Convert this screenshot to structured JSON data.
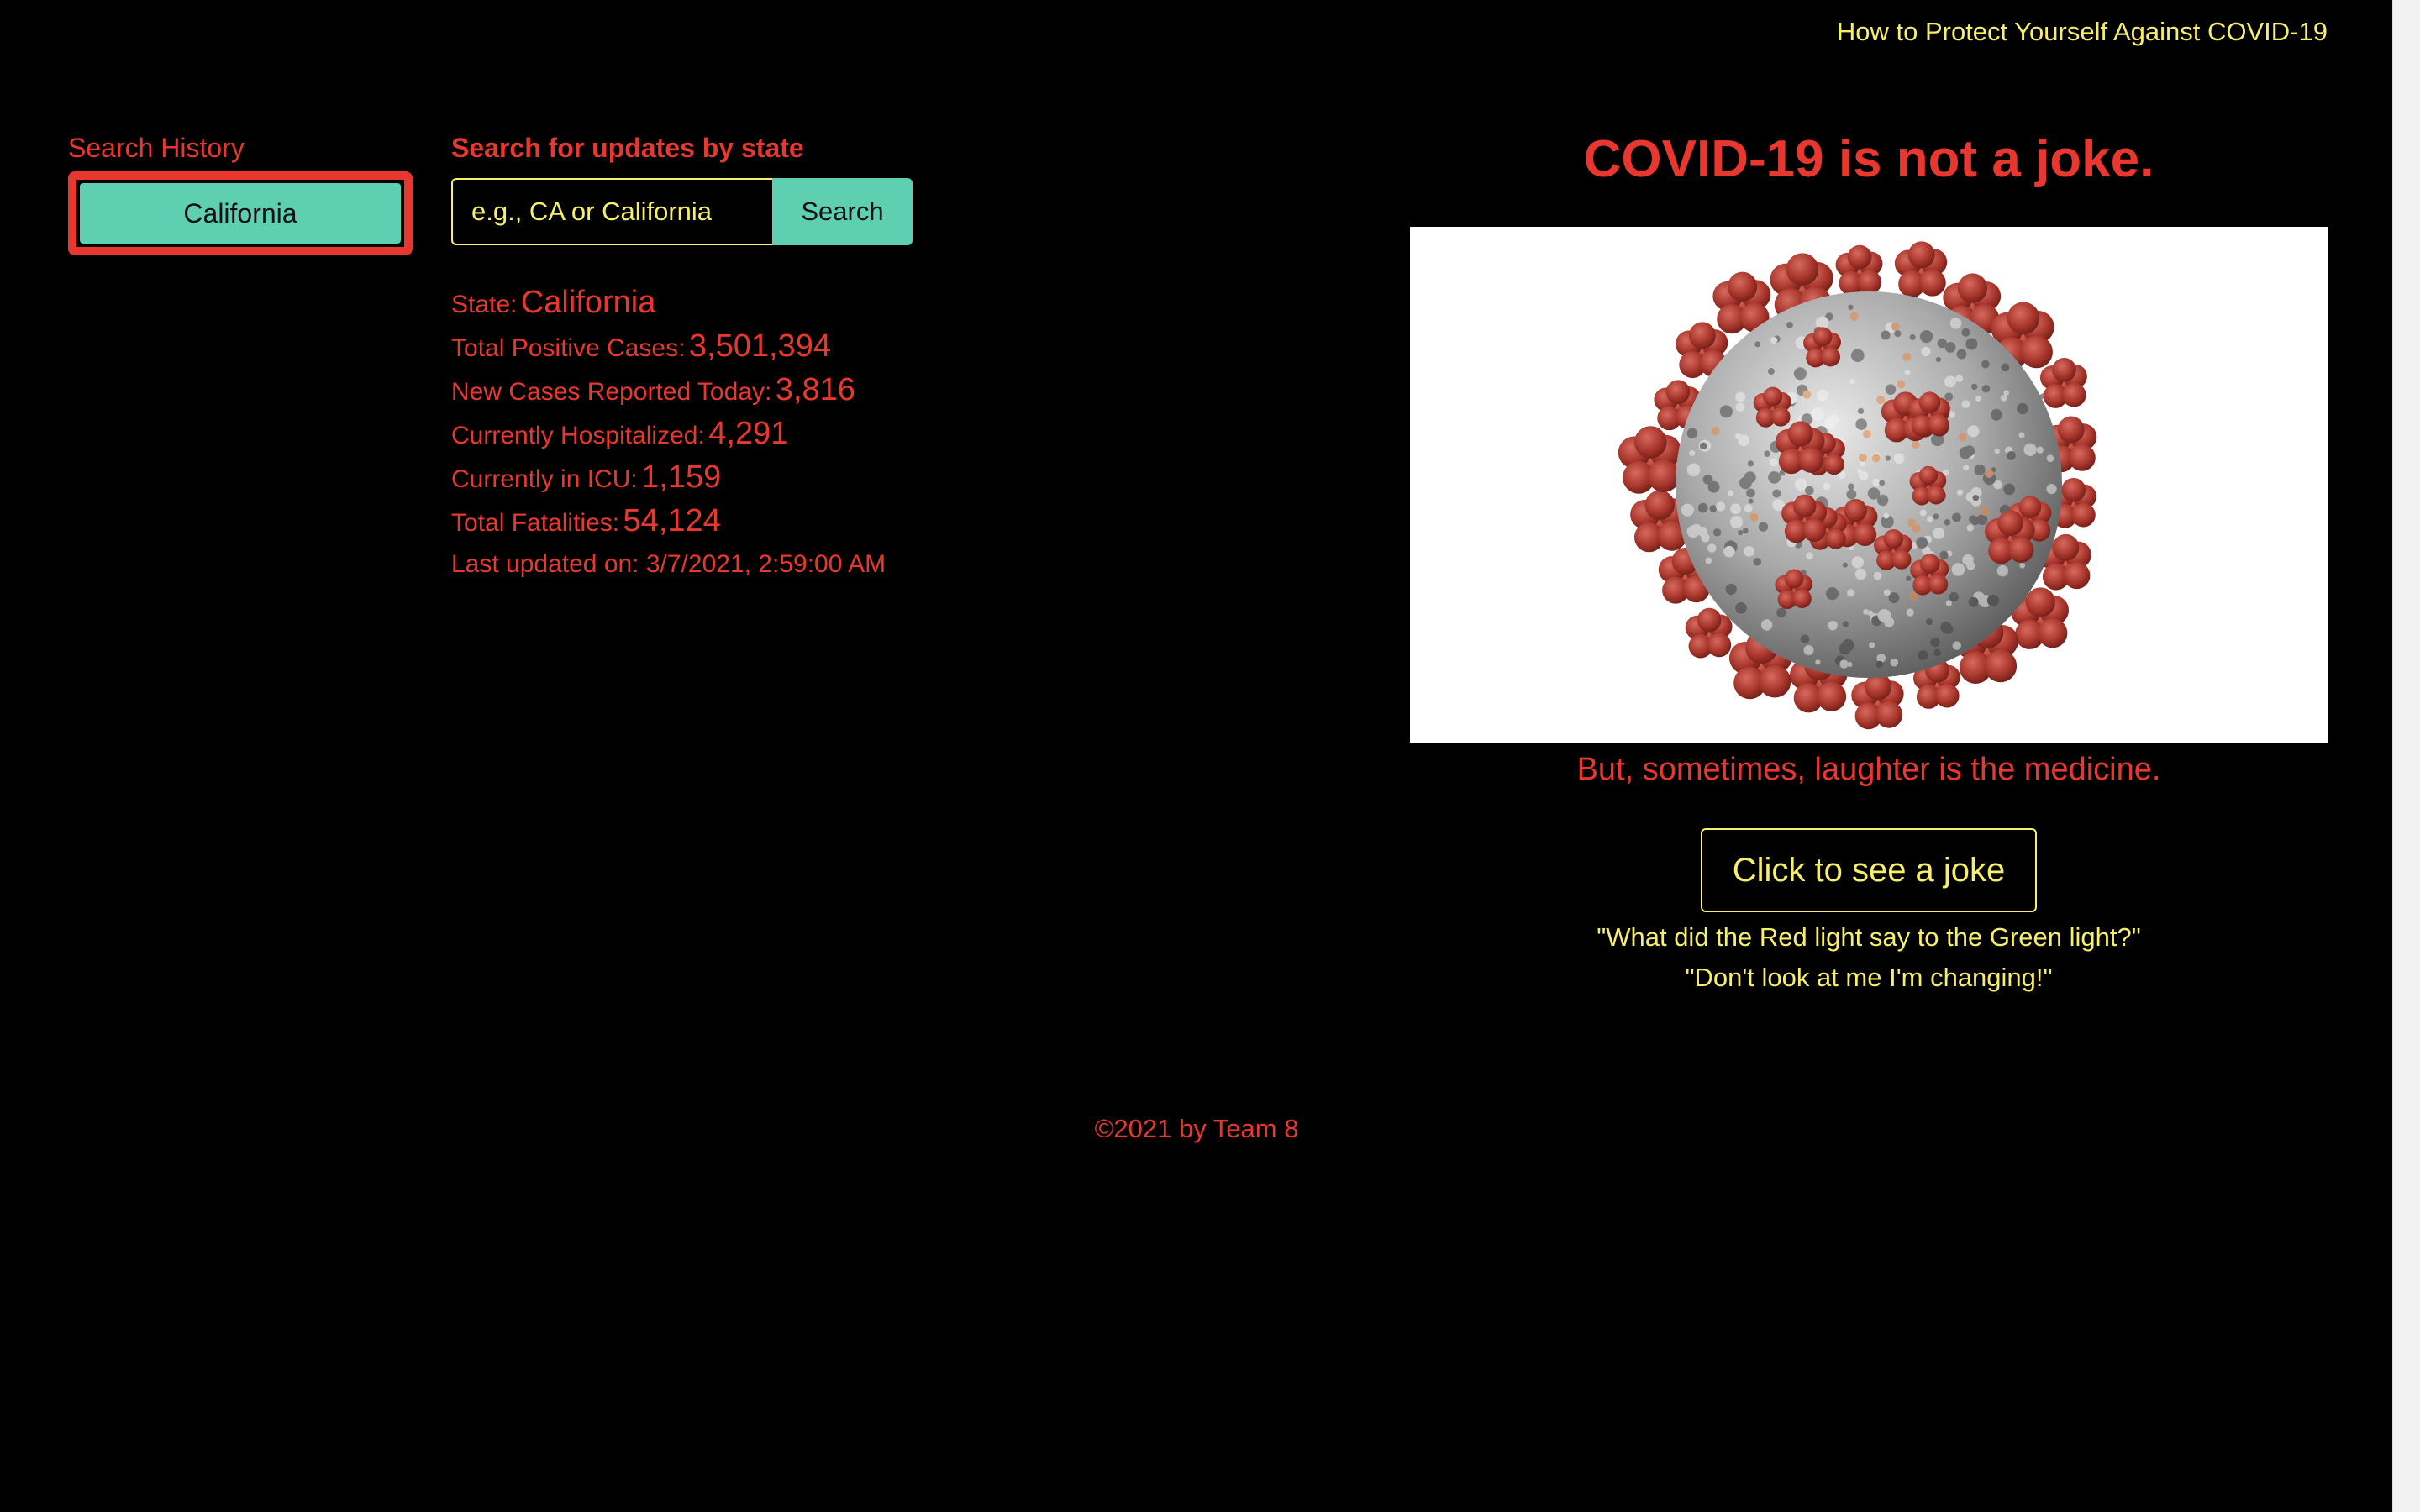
{
  "nav": {
    "protect_link": "How to Protect Yourself Against COVID-19"
  },
  "history": {
    "title": "Search History",
    "items": [
      {
        "label": "California"
      }
    ]
  },
  "search": {
    "title": "Search for updates by state",
    "placeholder": "e.g., CA or California",
    "button_label": "Search"
  },
  "stats": {
    "state_label": "State:",
    "state_value": "California",
    "positive_label": "Total Positive Cases:",
    "positive_value": "3,501,394",
    "new_label": "New Cases Reported Today:",
    "new_value": "3,816",
    "hosp_label": "Currently Hospitalized:",
    "hosp_value": "4,291",
    "icu_label": "Currently in ICU:",
    "icu_value": "1,159",
    "fatal_label": "Total Fatalities:",
    "fatal_value": "54,124",
    "updated": "Last updated on: 3/7/2021, 2:59:00 AM"
  },
  "hero": {
    "headline": "COVID-19 is not a joke.",
    "image_icon": "coronavirus-illustration",
    "tagline": "But, sometimes, laughter is the medicine.",
    "joke_button": "Click to see a joke",
    "joke_setup": "\"What did the Red light say to the Green light?\"",
    "joke_punchline": "\"Don't look at me I'm changing!\""
  },
  "footer": {
    "text": "©2021 by Team 8"
  },
  "colors": {
    "accent_red": "#e8372f",
    "accent_yellow": "#f7ee6a",
    "accent_teal": "#5fcfb2",
    "background": "#000000"
  }
}
